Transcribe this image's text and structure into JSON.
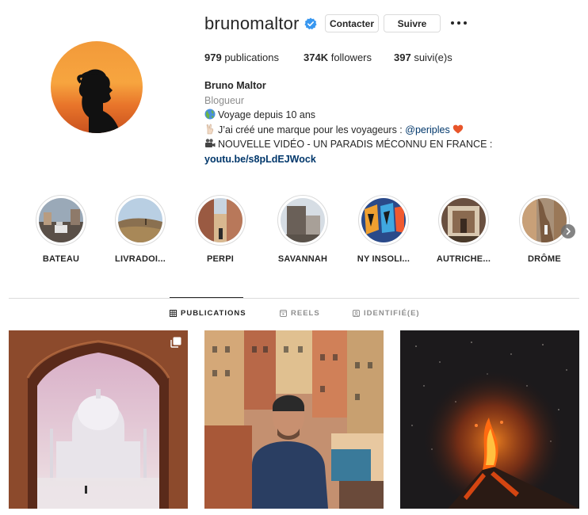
{
  "profile": {
    "username": "brunomaltor",
    "verified": true,
    "contact_label": "Contacter",
    "follow_label": "Suivre"
  },
  "stats": {
    "publications_count": "979",
    "publications_label": "publications",
    "followers_count": "374K",
    "followers_label": "followers",
    "following_count": "397",
    "following_label": "suivi(e)s"
  },
  "bio": {
    "name": "Bruno Maltor",
    "category": "Blogueur",
    "line1": "Voyage depuis 10 ans",
    "line2_text": "J’ai créé une marque pour les voyageurs : ",
    "line2_mention": "@periples",
    "line3": "NOUVELLE VIDÉO - UN PARADIS MÉCONNU EN FRANCE :",
    "link": "youtu.be/s8pLdEJWock"
  },
  "highlights": [
    {
      "label": "BATEAU"
    },
    {
      "label": "LIVRADOI..."
    },
    {
      "label": "PERPI"
    },
    {
      "label": "SAVANNAH"
    },
    {
      "label": "NY INSOLI..."
    },
    {
      "label": "AUTRICHE..."
    },
    {
      "label": "DRÔME"
    }
  ],
  "tabs": {
    "publications": "PUBLICATIONS",
    "reels": "REELS",
    "tagged": "IDENTIFIÉ(E)"
  },
  "icons": {
    "verified": "verified-badge-icon",
    "more": "more-options-icon",
    "grid": "grid-icon",
    "reels": "reels-icon",
    "tagged": "tagged-icon",
    "carousel": "carousel-icon",
    "next": "chevron-right-icon"
  },
  "colors": {
    "verified_blue": "#3897f0",
    "link_blue": "#00376b",
    "muted": "#8e8e8e",
    "border": "#dbdbdb"
  }
}
